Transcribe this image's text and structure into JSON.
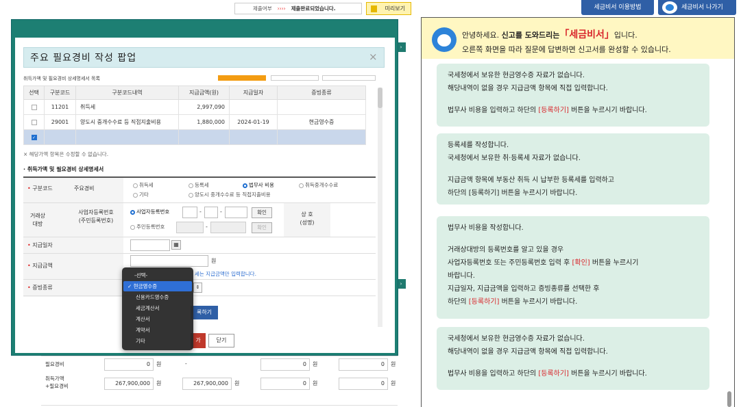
{
  "topbar": {
    "status_label": "제출여부",
    "status_arrow": "››››",
    "status_value": "제출완료되었습니다.",
    "preview_label": "미리보기"
  },
  "header_buttons": {
    "help_label": "세금비서 이용방법",
    "exit_label": "세금비서 나가기"
  },
  "modal": {
    "title": "주요 필요경비 작성 팝업",
    "close_glyph": "×",
    "section_partial_title": "취득가액 및 필요경비 상세명세서 목록",
    "columns": [
      "선택",
      "구분코드",
      "구분코드내역",
      "지급금액(원)",
      "지급일자",
      "증빙종류"
    ],
    "rows": [
      {
        "code": "11201",
        "desc": "취득세",
        "amount": "2,997,090",
        "date": "",
        "proof": ""
      },
      {
        "code": "29001",
        "desc": "양도시 중개수수료 등 직접지출비용",
        "amount": "1,880,000",
        "date": "2024-01-19",
        "proof": "현금영수증"
      }
    ],
    "note": "해당가액 항목은 수정할 수 없습니다.",
    "detail_title": "취득가액 및 필요경비 상세명세서",
    "form": {
      "code_label": "구분코드",
      "main_expense_label": "주요경비",
      "options": [
        "취득세",
        "등록세",
        "법무사 비용",
        "취득중개수수료",
        "기타",
        "양도시 중개수수료 등 직접지출비용"
      ],
      "selected_option": "법무사 비용",
      "party_label": "거래상대방",
      "id_label": "사업자등록번호\n(주민등록번호)",
      "biz_no_label": "사업자등록번호",
      "resident_no_label": "주민등록번호",
      "confirm_label": "확인",
      "name_label": "상 호\n(성명)",
      "date_label": "지급일자",
      "amount_label": "지급금액",
      "won": "원",
      "amount_hint": "세는 지급금액만 입력합니다.",
      "proof_label": "증빙종류"
    },
    "dropdown": {
      "items": [
        "-선택-",
        "현금영수증",
        "신용카드영수증",
        "세금계산서",
        "계산서",
        "계약서",
        "기타"
      ],
      "selected": "현금영수증"
    },
    "register_label": "록하기",
    "red_btn_label": "가",
    "close_label": "닫기"
  },
  "background": {
    "rows": [
      {
        "label": "필요경비",
        "values": [
          "0",
          "-",
          "0",
          "0"
        ]
      },
      {
        "label": "취득가액\n+필요경비",
        "values": [
          "267,900,000",
          "267,900,000",
          "0",
          "0"
        ]
      }
    ],
    "unit": "원"
  },
  "greeting": {
    "line1_pre": "안녕하세요. ",
    "line1_bold": "신고를 도와드리는",
    "line1_brand": "「세금비서」",
    "line1_post": "입니다.",
    "line2": "오른쪽 화면을 따라 질문에 답변하면 신고서를 완성할 수 있습니다."
  },
  "messages": [
    {
      "l1": "국세청에서 보유한 현금영수증 자료가 없습니다.",
      "l2": "해당내역이 없을 경우 지급금액 항목에 직접 입력합니다.",
      "l3_pre": "법무사 비용을 입력하고 하단의 ",
      "l3_hl": "[등록하기]",
      "l3_post": " 버튼을 누르시기 바랍니다."
    },
    {
      "l1": "등록세를 작성합니다.",
      "l2": "국세청에서 보유한 취·등록세 자료가 없습니다.",
      "l3": "지급금액 항목에 부동산 취득 시 납부한 등록세를 입력하고",
      "l4": "하단의 [등록하기] 버튼을 누르시기 바랍니다."
    },
    {
      "l1": "법무사 비용을 작성합니다.",
      "l2": "거래상대방의 등록번호를 알고 있을 경우",
      "l3_pre": "사업자등록번호 또는 주민등록번호 입력 후 ",
      "l3_hl": "[확인]",
      "l3_post": " 버튼을 누르시기",
      "l4": "바랍니다.",
      "l5": "지급일자, 지급금액을 입력하고 증빙종류를 선택한 후",
      "l6_pre": "하단의 ",
      "l6_hl": "[등록하기]",
      "l6_post": " 버튼을 누르시기 바랍니다."
    },
    {
      "l1": "국세청에서 보유한 현금영수증 자료가 없습니다.",
      "l2": "해당내역이 없을 경우 지급금액 항목에 직접 입력합니다.",
      "l3_pre": "법무사 비용을 입력하고 하단의 ",
      "l3_hl": "[등록하기]",
      "l3_post": " 버튼을 누르시기 바랍니다."
    }
  ]
}
